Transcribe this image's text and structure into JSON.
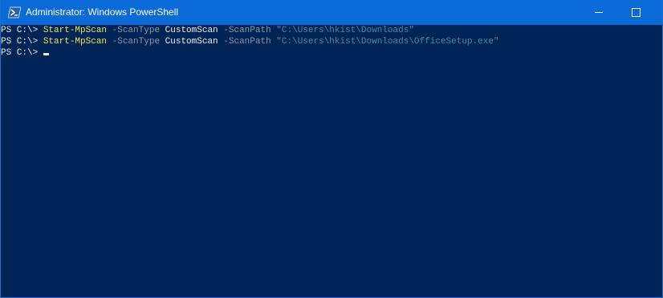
{
  "window": {
    "title": "Administrator: Windows PowerShell",
    "icon": "powershell-icon"
  },
  "controls": {
    "minimize_icon": "minimize-icon",
    "maximize_icon": "maximize-icon"
  },
  "colors": {
    "console_background": "#012456",
    "titlebar": "#0a6ad8",
    "cmdlet": "#f3e15f",
    "parameter": "#8a96a8",
    "string": "#3d8fa6",
    "text": "#eeedf0"
  },
  "console": {
    "lines": [
      {
        "prompt": "PS C:\\> ",
        "cmdlet": "Start-MpScan",
        "param1": " -ScanType",
        "value1": " CustomScan",
        "param2": " -ScanPath",
        "string": " \"C:\\Users\\hkist\\Downloads\""
      },
      {
        "prompt": "PS C:\\> ",
        "cmdlet": "Start-MpScan",
        "param1": " -ScanType",
        "value1": " CustomScan",
        "param2": " -ScanPath",
        "string": " \"C:\\Users\\hkist\\Downloads\\OfficeSetup.exe\""
      }
    ],
    "current_prompt": "PS C:\\> "
  }
}
